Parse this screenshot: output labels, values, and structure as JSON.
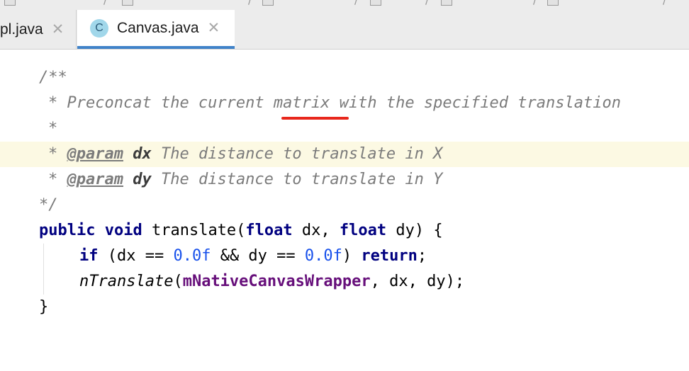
{
  "tabs": [
    {
      "label": "pl.java",
      "active": false,
      "close": "✕"
    },
    {
      "label": "Canvas.java",
      "active": true,
      "icon_letter": "C",
      "close": "✕"
    }
  ],
  "colors": {
    "keyword": "#000080",
    "number": "#1750eb",
    "comment": "#7b7b7b",
    "field": "#660e7a",
    "highlight_line": "#fcf9e3",
    "active_tab_underline": "#4083c9",
    "typo_underline": "#e8271c"
  },
  "code": {
    "l1": "/**",
    "l2_star": "* ",
    "l2_a": "Preconcat the current ",
    "l2_b": "matrix",
    "l2_c": " with the specified translation",
    "l3": "*",
    "l4_star": "* ",
    "l4_tag": "@param",
    "l4_param": "dx",
    "l4_desc": " The distance to translate in X",
    "l5_star": "* ",
    "l5_tag": "@param",
    "l5_param": "dy",
    "l5_desc": " The distance to translate in Y",
    "l6": "*/",
    "l7_kw1": "public",
    "l7_kw2": "void",
    "l7_name": "translate(",
    "l7_kw3": "float",
    "l7_p1": "dx, ",
    "l7_kw4": "float",
    "l7_p2": "dy) {",
    "l8_kw1": "if",
    "l8_a": " (dx == ",
    "l8_n1": "0.0f",
    "l8_b": " && dy == ",
    "l8_n2": "0.0f",
    "l8_c": ") ",
    "l8_kw2": "return",
    "l8_d": ";",
    "l9_call": "nTranslate",
    "l9_a": "(",
    "l9_field": "mNativeCanvasWrapper",
    "l9_b": ", dx, dy);",
    "l10": "}"
  }
}
